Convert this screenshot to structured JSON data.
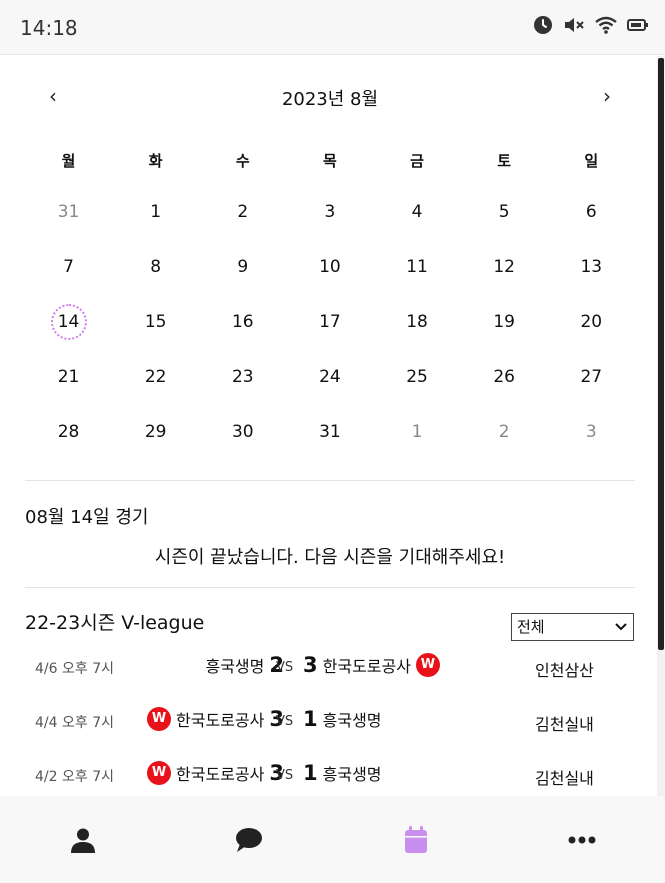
{
  "status": {
    "time": "14:18"
  },
  "calendar": {
    "title": "2023년 8월",
    "prev_label": "‹",
    "next_label": "›",
    "weekdays": [
      "월",
      "화",
      "수",
      "목",
      "금",
      "토",
      "일"
    ],
    "weeks": [
      [
        "31",
        "1",
        "2",
        "3",
        "4",
        "5",
        "6"
      ],
      [
        "7",
        "8",
        "9",
        "10",
        "11",
        "12",
        "13"
      ],
      [
        "14",
        "15",
        "16",
        "17",
        "18",
        "19",
        "20"
      ],
      [
        "21",
        "22",
        "23",
        "24",
        "25",
        "26",
        "27"
      ],
      [
        "28",
        "29",
        "30",
        "31",
        "1",
        "2",
        "3"
      ]
    ],
    "selected_day": "14",
    "accent_color": "#d27bea"
  },
  "games": {
    "date_heading": "08월 14일 경기",
    "message": "시즌이 끝났습니다. 다음 시즌을 기대해주세요!"
  },
  "season": {
    "title": "22-23시즌 V-league",
    "filter_value": "전체",
    "vs_label": "VS",
    "winner_badge": "W",
    "winner_color": "#e8131a",
    "matches": [
      {
        "date": "4/6 오후 7시",
        "home": "흥국생명",
        "home_score": "2",
        "away_score": "3",
        "away": "한국도로공사",
        "venue": "인천삼산"
      },
      {
        "date": "4/4 오후 7시",
        "home": "한국도로공사",
        "home_score": "3",
        "away_score": "1",
        "away": "흥국생명",
        "venue": "김천실내"
      },
      {
        "date": "4/2 오후 7시",
        "home": "한국도로공사",
        "home_score": "3",
        "away_score": "1",
        "away": "흥국생명",
        "venue": "김천실내"
      }
    ]
  },
  "nav": {
    "items": [
      {
        "icon": "user-icon",
        "active": false
      },
      {
        "icon": "chat-icon",
        "active": false
      },
      {
        "icon": "calendar-icon",
        "active": true
      },
      {
        "icon": "more-icon",
        "active": false
      }
    ],
    "active_color": "#c98ff0"
  }
}
